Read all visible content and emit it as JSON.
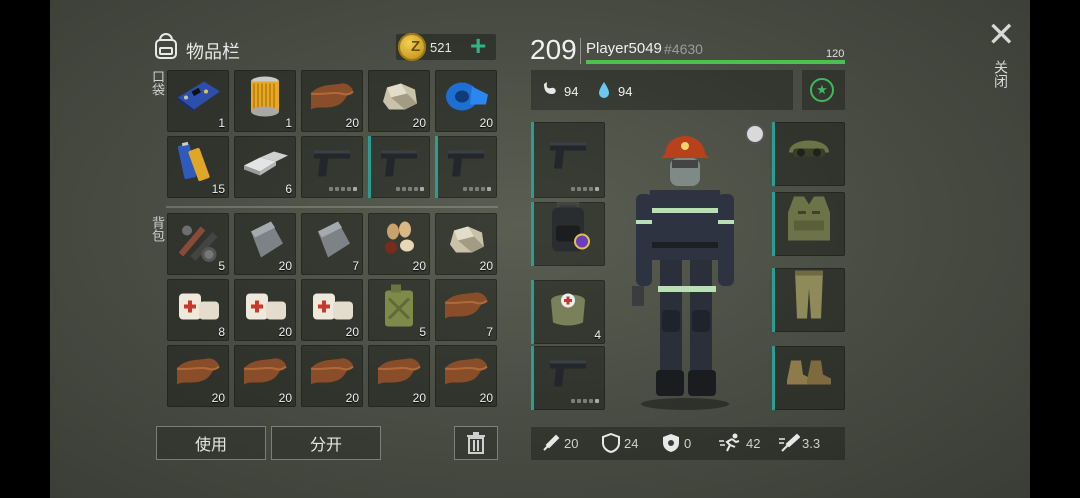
{
  "inventory": {
    "title": "物品栏",
    "coins": 521,
    "coin_symbol": "Z",
    "pocket_label": "口袋",
    "backpack_label": "背包",
    "pocket_slots": [
      {
        "icon": "circuit-board-icon",
        "count": "1"
      },
      {
        "icon": "filter-icon",
        "count": "1"
      },
      {
        "icon": "leather-icon",
        "count": "20"
      },
      {
        "icon": "stone-icon",
        "count": "20"
      },
      {
        "icon": "tape-icon",
        "count": "20"
      },
      {
        "icon": "batteries-icon",
        "count": "15"
      },
      {
        "icon": "iron-ingot-icon",
        "count": "6"
      },
      {
        "icon": "pistol-icon",
        "count": ""
      },
      {
        "icon": "pistol-icon",
        "count": ""
      },
      {
        "icon": "pistol-icon",
        "count": ""
      }
    ],
    "backpack_slots": [
      {
        "icon": "tools-icon",
        "count": "5"
      },
      {
        "icon": "steel-plate-icon",
        "count": "20"
      },
      {
        "icon": "steel-plate-icon",
        "count": "7"
      },
      {
        "icon": "seeds-icon",
        "count": "20"
      },
      {
        "icon": "stone-icon",
        "count": "20"
      },
      {
        "icon": "bandage-icon",
        "count": "8"
      },
      {
        "icon": "bandage-icon",
        "count": "20"
      },
      {
        "icon": "bandage-icon",
        "count": "20"
      },
      {
        "icon": "jerrycan-icon",
        "count": "5"
      },
      {
        "icon": "leather-icon",
        "count": "7"
      },
      {
        "icon": "leather-icon",
        "count": "20"
      },
      {
        "icon": "leather-icon",
        "count": "20"
      },
      {
        "icon": "leather-icon",
        "count": "20"
      },
      {
        "icon": "leather-icon",
        "count": "20"
      },
      {
        "icon": "leather-icon",
        "count": "20"
      }
    ],
    "use_label": "使用",
    "split_label": "分开"
  },
  "player": {
    "level": "209",
    "name": "Player5049",
    "id": "#4630",
    "xp_value": "120",
    "xp_fraction": 1.0,
    "hunger": "94",
    "thirst": "94"
  },
  "equipment": {
    "left": [
      {
        "icon": "pistol-icon",
        "count": ""
      },
      {
        "icon": "backpack-icon",
        "count": ""
      },
      {
        "icon": "medkit-icon",
        "count": "4"
      },
      {
        "icon": "pistol-icon",
        "count": ""
      }
    ],
    "right": [
      {
        "icon": "helmet-icon"
      },
      {
        "icon": "vest-icon"
      },
      {
        "icon": "pants-icon"
      },
      {
        "icon": "boots-icon"
      }
    ]
  },
  "stats": {
    "attack": "20",
    "defense": "24",
    "radiation": "0",
    "speed": "42",
    "reload": "3.3"
  },
  "close_label": "关闭",
  "colors": {
    "accent_teal": "#2c9c94",
    "xp_green": "#4fbf4f",
    "plus_green": "#2fb38a"
  }
}
